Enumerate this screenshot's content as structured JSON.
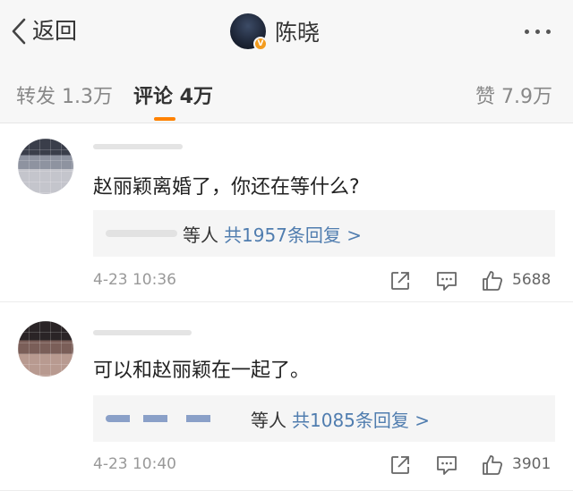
{
  "header": {
    "back_label": "返回",
    "user_name": "陈晓",
    "verified_badge": "V"
  },
  "tabs": {
    "repost": "转发 1.3万",
    "comment": "评论 4万",
    "like": "赞 7.9万"
  },
  "comments": [
    {
      "text": "赵丽颖离婚了，你还在等什么?",
      "reply_suffix": "等人",
      "reply_link": "共1957条回复 >",
      "time": "4-23 10:36",
      "likes": "5688"
    },
    {
      "text": "可以和赵丽颖在一起了。",
      "reply_suffix": "等人",
      "reply_link": "共1085条回复 >",
      "time": "4-23 10:40",
      "likes": "3901"
    }
  ],
  "colors": {
    "accent": "#ff8200",
    "link": "#507daf",
    "verified": "#f39c1f"
  }
}
